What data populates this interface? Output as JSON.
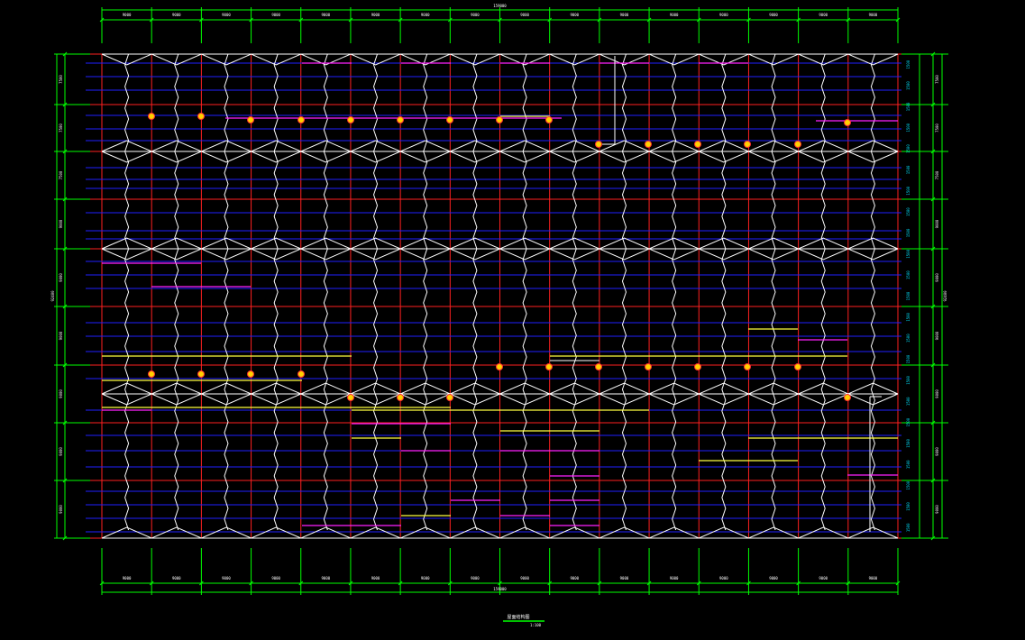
{
  "drawing": {
    "background": "#000000",
    "title": "屋面结构图",
    "scale": "1:100",
    "colors": {
      "dimension": "#00ff00",
      "axis_red": "#ff2020",
      "purlin_blue": "#2020ff",
      "truss_white": "#ffffff",
      "yellow": "#ffff40",
      "magenta": "#ff20ff",
      "cyan": "#00e5ff",
      "node_fill": "#ffd000",
      "node_ring": "#ff3030"
    },
    "top_overall_dim": "159000",
    "bottom_overall_dim": "159000",
    "left_overall_dim": "92400",
    "right_overall_dim": "92400",
    "top_span_dims": [
      "9000",
      "9000",
      "9000",
      "9000",
      "9000",
      "9000",
      "9000",
      "9000",
      "9000",
      "9000",
      "9000",
      "9000",
      "9000",
      "9000",
      "9000",
      "9000"
    ],
    "bottom_span_dims": [
      "9000",
      "9000",
      "9000",
      "9000",
      "9000",
      "9000",
      "9000",
      "9000",
      "9000",
      "9000",
      "9000",
      "9000",
      "9000",
      "9000",
      "9000",
      "9000"
    ],
    "left_row_dims": [
      "7500",
      "7500",
      "7500",
      "9000",
      "9000",
      "9000",
      "9000",
      "9000",
      "9000"
    ],
    "right_row_dims": [
      "7500",
      "7500",
      "7500",
      "9000",
      "9000",
      "9000",
      "9000",
      "9000",
      "9000"
    ],
    "right_purlin_dims": [
      "1500",
      "1500",
      "1500",
      "1500",
      "1500",
      "1500",
      "1500",
      "1500",
      "1500",
      "1500",
      "1500",
      "1500",
      "1500",
      "1500",
      "1500",
      "1500",
      "1500",
      "1500",
      "1500",
      "1500",
      "1500",
      "1500",
      "1500"
    ]
  }
}
